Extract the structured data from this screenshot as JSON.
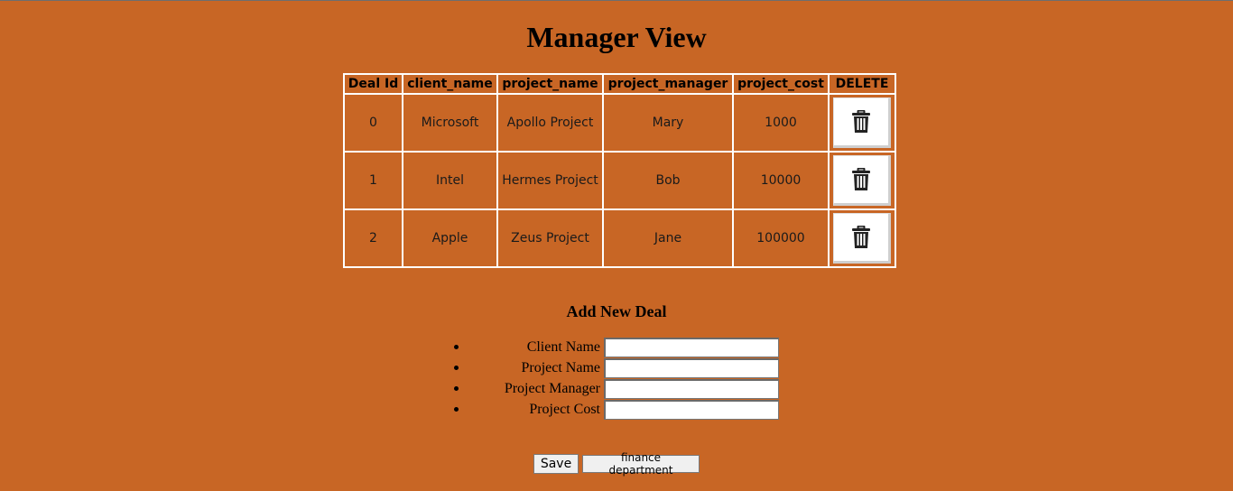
{
  "title": "Manager View",
  "table": {
    "headers": [
      "Deal Id",
      "client_name",
      "project_name",
      "project_manager",
      "project_cost",
      "DELETE"
    ],
    "rows": [
      {
        "id": "0",
        "client_name": "Microsoft",
        "project_name": "Apollo Project",
        "project_manager": "Mary",
        "project_cost": "1000",
        "delete_icon": "trash-icon"
      },
      {
        "id": "1",
        "client_name": "Intel",
        "project_name": "Hermes Project",
        "project_manager": "Bob",
        "project_cost": "10000",
        "delete_icon": "trash-icon"
      },
      {
        "id": "2",
        "client_name": "Apple",
        "project_name": "Zeus Project",
        "project_manager": "Jane",
        "project_cost": "100000",
        "delete_icon": "trash-icon"
      }
    ]
  },
  "form": {
    "title": "Add New Deal",
    "fields": [
      {
        "label": "Client Name",
        "value": ""
      },
      {
        "label": "Project Name",
        "value": ""
      },
      {
        "label": "Project Manager",
        "value": ""
      },
      {
        "label": "Project Cost",
        "value": ""
      }
    ]
  },
  "buttons": {
    "save": "Save",
    "finance": "finance department"
  },
  "colors": {
    "background": "#c86625",
    "border": "#ffffff"
  }
}
